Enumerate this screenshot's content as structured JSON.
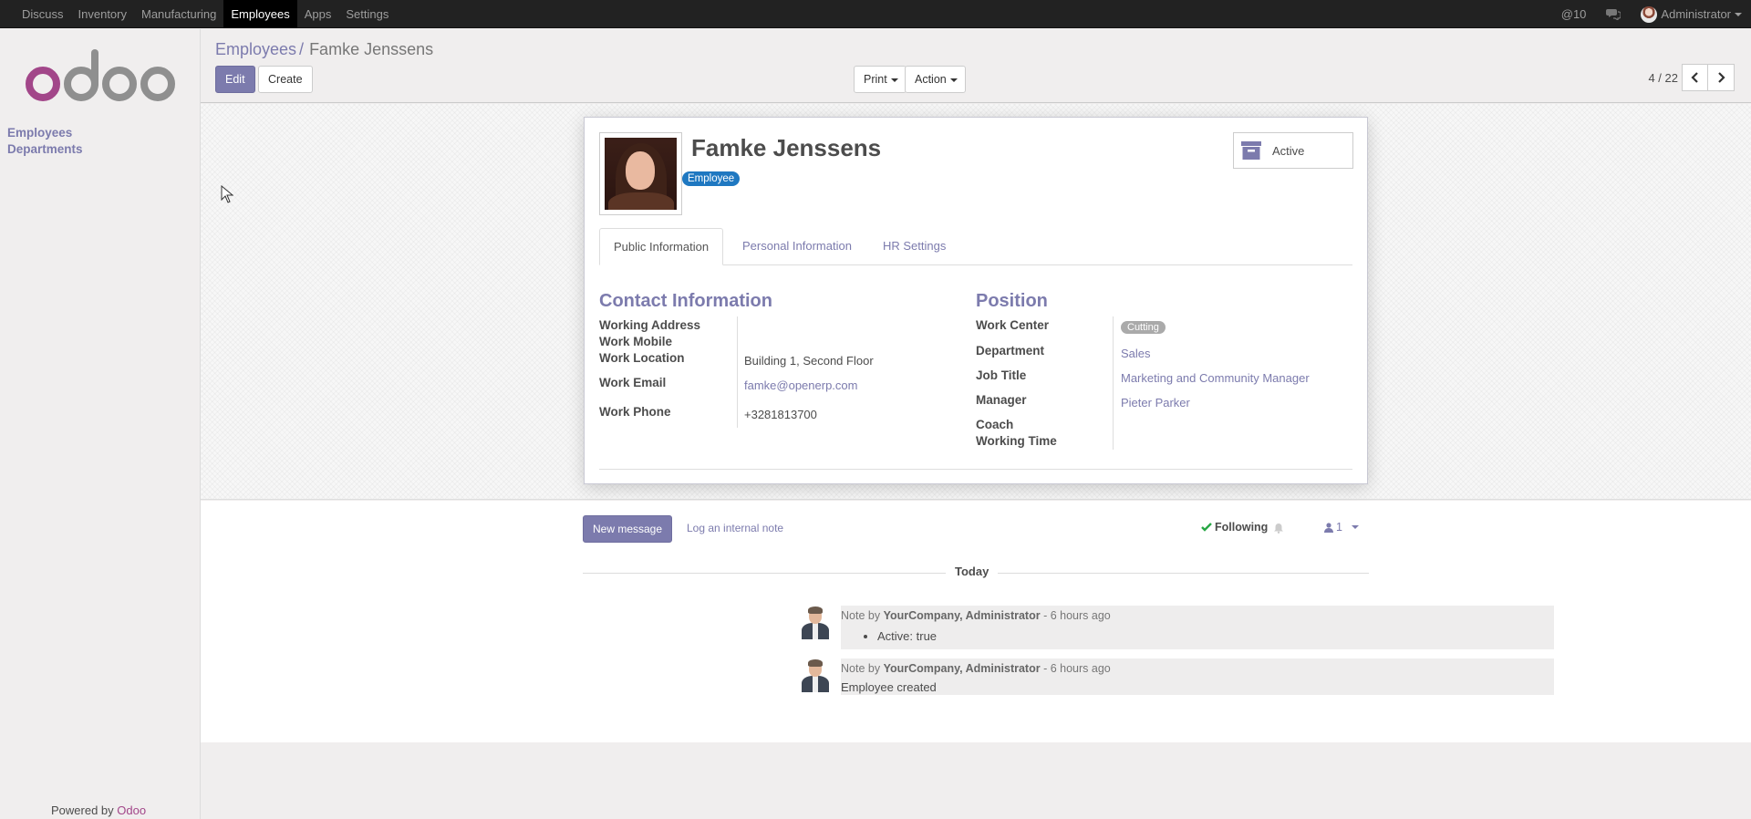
{
  "colors": {
    "accent": "#7c7bad",
    "brand": "#a24689",
    "tag": "#1f78c1",
    "navbar": "#222222"
  },
  "navbar": {
    "menu": [
      "Discuss",
      "Inventory",
      "Manufacturing",
      "Employees",
      "Apps",
      "Settings"
    ],
    "active": "Employees",
    "mentions": "@10",
    "chat_icon": "comments-icon",
    "user": "Administrator"
  },
  "sidebar": {
    "items": [
      "Employees",
      "Departments"
    ],
    "powered_prefix": "Powered by",
    "powered_brand": "Odoo"
  },
  "breadcrumb": {
    "parent": "Employees",
    "separator": "/",
    "current": "Famke Jenssens"
  },
  "buttons": {
    "edit": "Edit",
    "create": "Create",
    "print": "Print",
    "action": "Action"
  },
  "pager": {
    "value": "4 / 22"
  },
  "employee": {
    "name": "Famke Jenssens",
    "tag": "Employee",
    "status_button": "Active",
    "status_icon": "archive-icon"
  },
  "tabs": [
    "Public Information",
    "Personal Information",
    "HR Settings"
  ],
  "contact": {
    "title": "Contact Information",
    "labels": {
      "address": "Working Address",
      "mobile": "Work Mobile",
      "location": "Work Location",
      "email": "Work Email",
      "phone": "Work Phone"
    },
    "values": {
      "location": "Building 1, Second Floor",
      "email": "famke@openerp.com",
      "phone": "+3281813700"
    }
  },
  "position": {
    "title": "Position",
    "labels": {
      "work_center": "Work Center",
      "department": "Department",
      "job_title": "Job Title",
      "manager": "Manager",
      "coach": "Coach",
      "working_time": "Working Time"
    },
    "values": {
      "work_center": "Cutting",
      "department": "Sales",
      "job_title": "Marketing and Community Manager",
      "manager": "Pieter Parker"
    }
  },
  "chatter": {
    "new_message": "New message",
    "log_note": "Log an internal note",
    "following": "Following",
    "followers": "1",
    "date_separator": "Today",
    "messages": [
      {
        "prefix": "Note by",
        "author": "YourCompany, Administrator",
        "time": "- 6 hours ago",
        "body_item": "Active: true"
      },
      {
        "prefix": "Note by",
        "author": "YourCompany, Administrator",
        "time": "- 6 hours ago",
        "body": "Employee created"
      }
    ]
  }
}
